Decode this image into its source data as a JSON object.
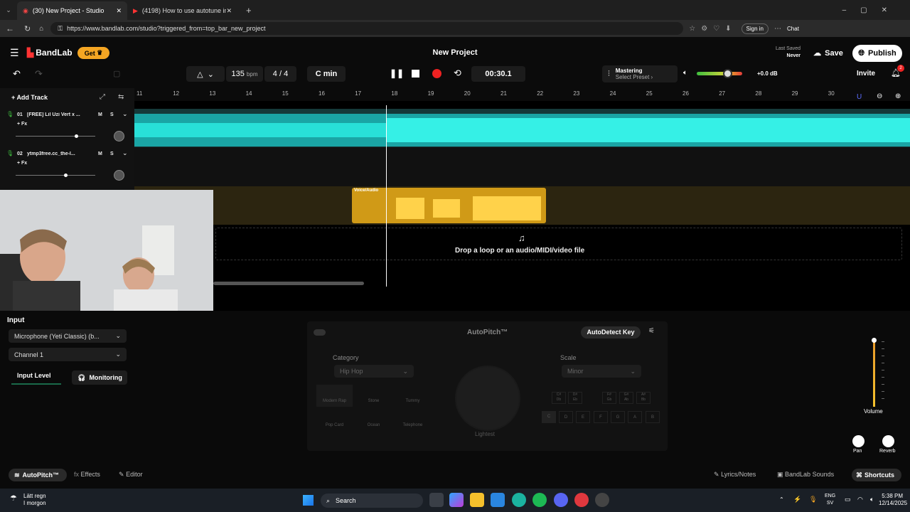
{
  "browser": {
    "tabs": [
      {
        "label": "(30) New Project - Studio"
      },
      {
        "label": "(4198) How to use autotune in ba"
      }
    ],
    "url": "https://www.bandlab.com/studio?triggered_from=top_bar_new_project",
    "sign_in": "Sign in",
    "chat": "Chat"
  },
  "header": {
    "logo": "BandLab",
    "get": "Get",
    "project_title": "New Project",
    "last_saved_label": "Last Saved",
    "last_saved_value": "Never",
    "save": "Save",
    "publish": "Publish",
    "invite": "Invite",
    "notif_count": "2"
  },
  "transport": {
    "bpm": "135",
    "bpm_unit": "bpm",
    "time_sig": "4 / 4",
    "key": "C min",
    "time": "00:30.1",
    "mastering": "Mastering",
    "select_preset": "Select Preset",
    "volume_db": "+0.0 dB"
  },
  "ruler": {
    "bars": [
      "11",
      "12",
      "13",
      "14",
      "15",
      "16",
      "17",
      "18",
      "19",
      "20",
      "21",
      "22",
      "23",
      "24",
      "25",
      "26",
      "27",
      "28",
      "29",
      "30"
    ]
  },
  "tracks": {
    "add_track": "Add Track",
    "items": [
      {
        "number": "01",
        "name": "[FREE] Lil Uzi Vert x ...",
        "fx": "+ Fx",
        "m": "M",
        "s": "S"
      },
      {
        "number": "02",
        "name": "ytmp3free.cc_the-l...",
        "fx": "+ Fx",
        "m": "M",
        "s": "S"
      }
    ]
  },
  "arrangement": {
    "region_label": "Voice/Audio",
    "drop_text": "Drop a loop or an audio/MIDI/video file"
  },
  "input": {
    "title": "Input",
    "device": "Microphone (Yeti Classic) (b...",
    "channel": "Channel 1",
    "input_level": "Input Level",
    "monitoring": "Monitoring"
  },
  "autopitch": {
    "title": "AutoPitch™",
    "autodetect": "AutoDetect Key",
    "category_label": "Category",
    "category": "Hip Hop",
    "scale_label": "Scale",
    "scale": "Minor",
    "knob_label": "Lightest",
    "presets": [
      "Modern Rap",
      "Stone",
      "Tummy",
      "Pop Card",
      "Ocean",
      "Telephone"
    ],
    "sharps": [
      "C#\nDb",
      "D#\nEb",
      "F#\nGb",
      "G#\nAb",
      "A#\nBb"
    ],
    "naturals": [
      "C",
      "D",
      "E",
      "F",
      "G",
      "A",
      "B"
    ],
    "volume": "Volume",
    "pan": "Pan",
    "reverb": "Reverb"
  },
  "bottom_tabs": {
    "autopitch": "AutoPitch™",
    "effects": "Effects",
    "editor": "Editor",
    "lyrics": "Lyrics/Notes",
    "sounds": "BandLab Sounds",
    "shortcuts": "Shortcuts"
  },
  "taskbar": {
    "weather_1": "Lätt regn",
    "weather_2": "I morgon",
    "search": "Search",
    "lang_1": "ENG",
    "lang_2": "SV",
    "time": "5:38 PM",
    "date": "12/14/2025"
  }
}
